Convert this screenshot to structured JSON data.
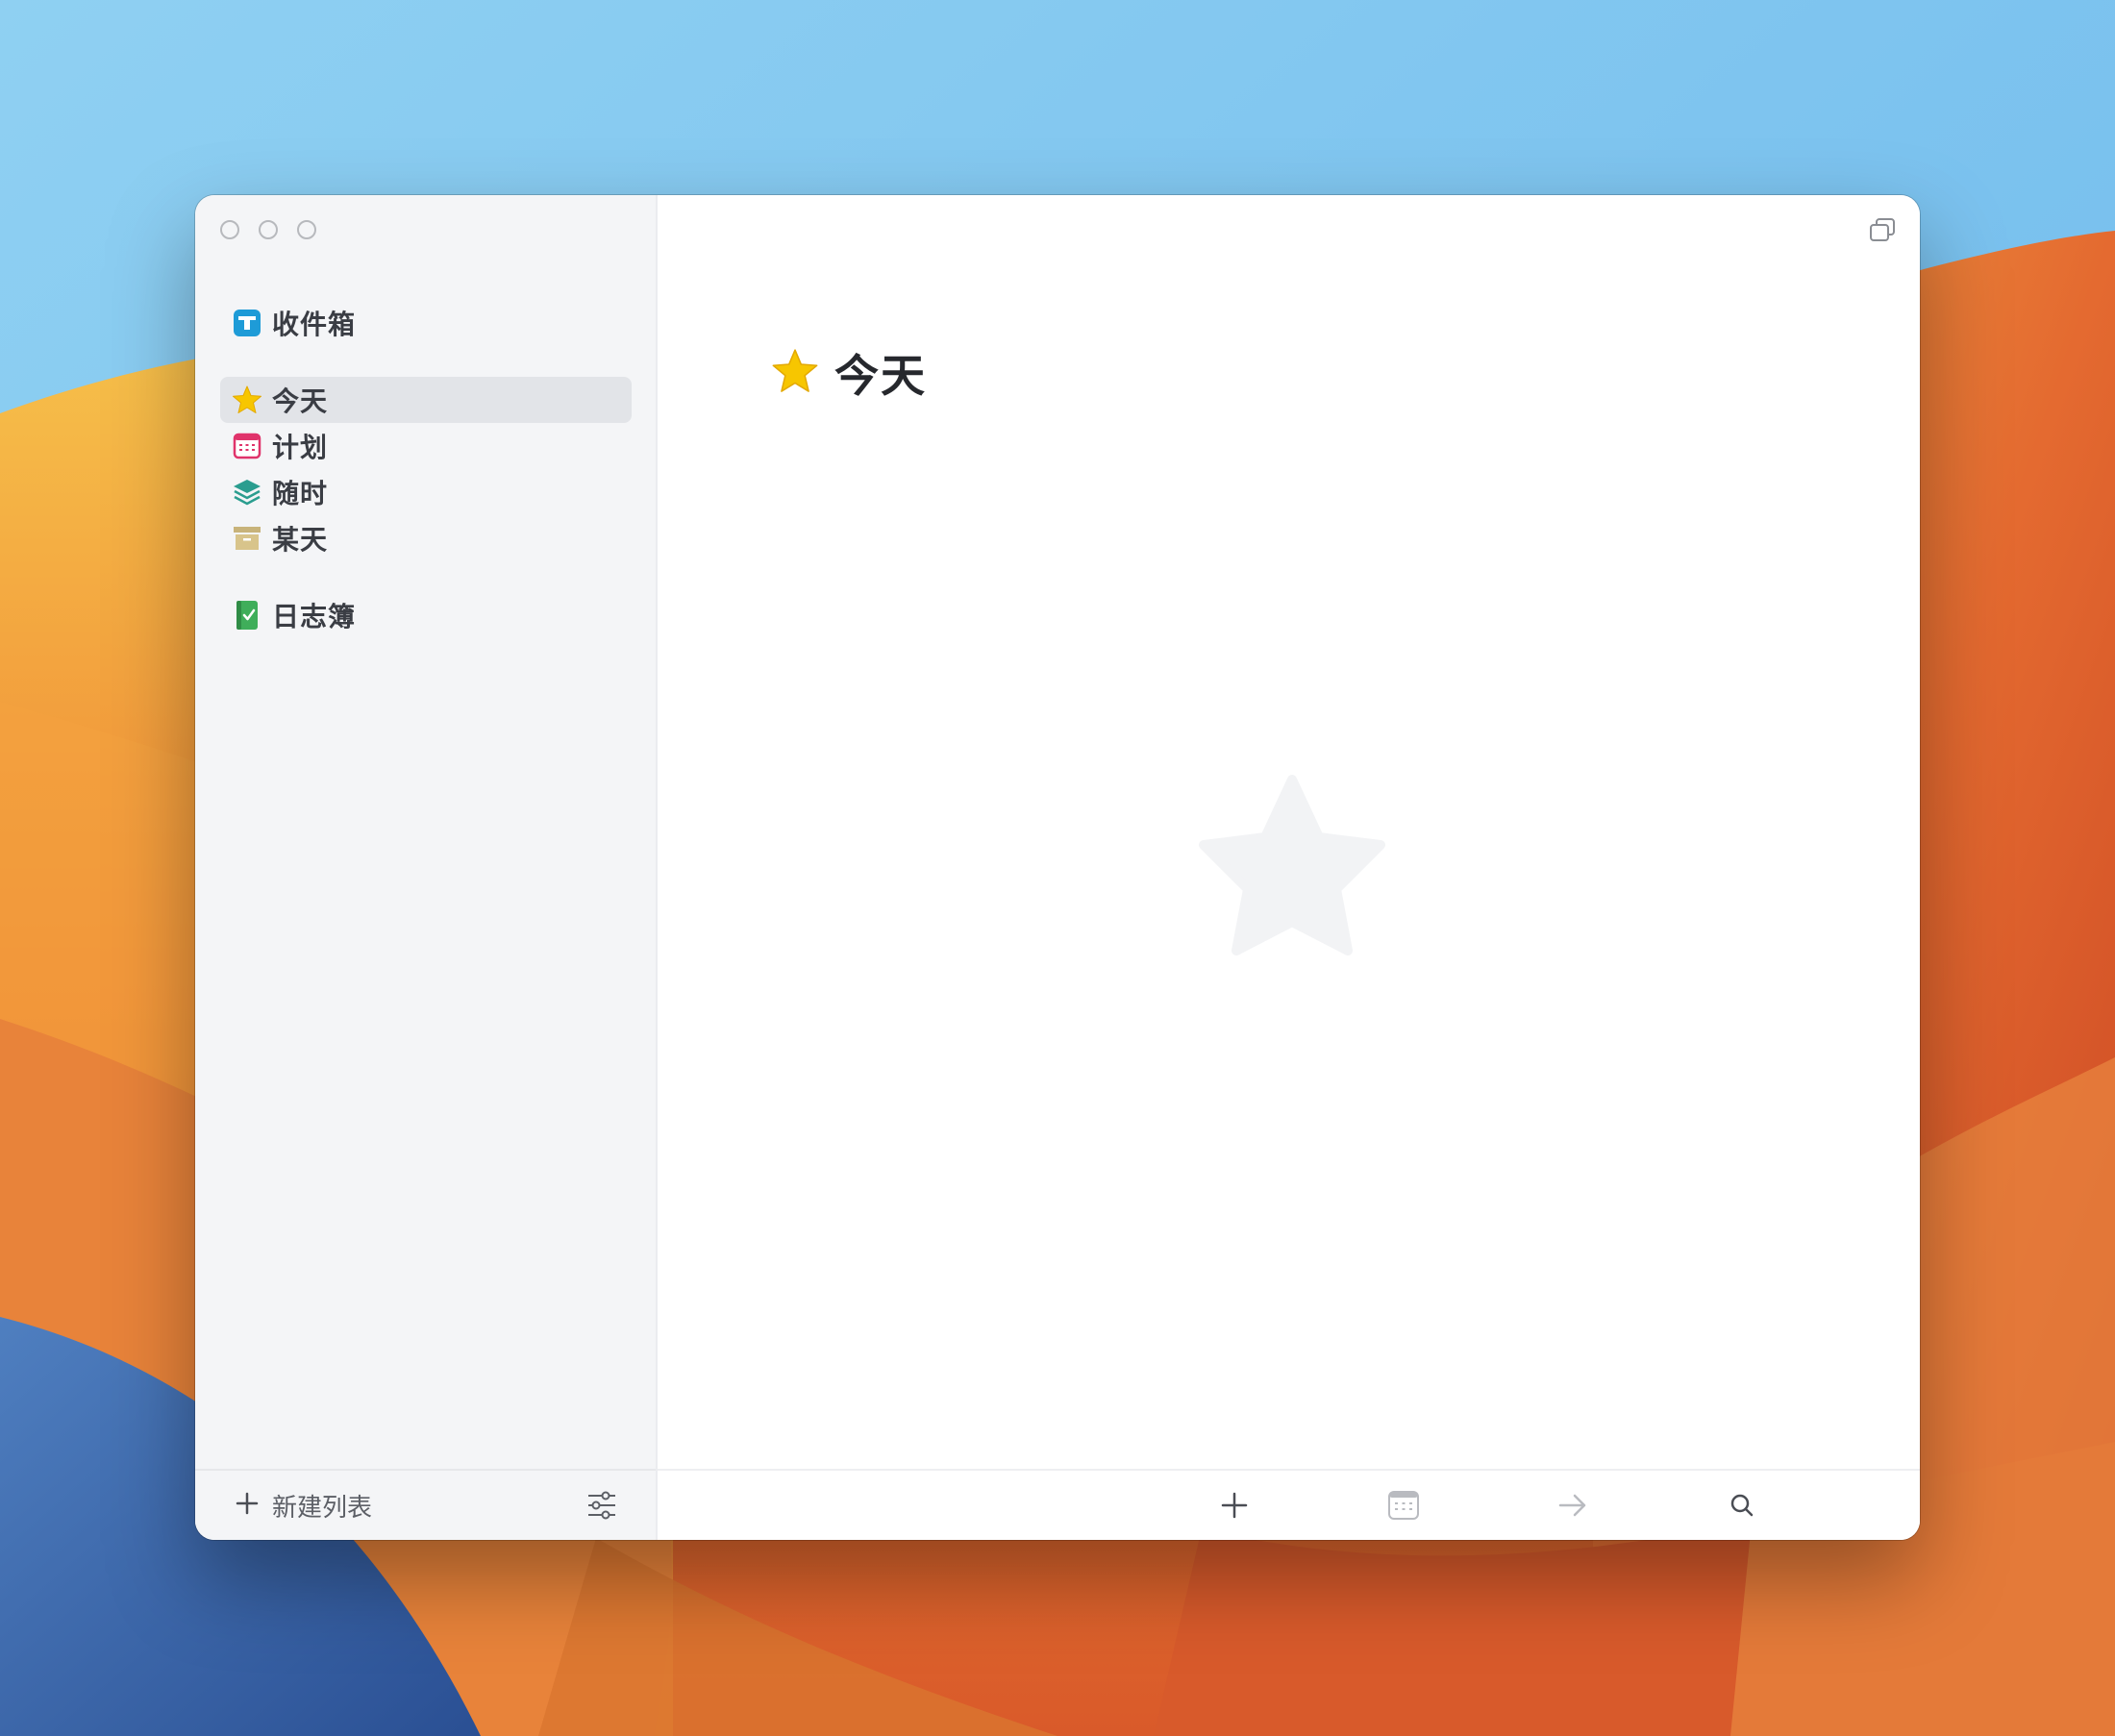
{
  "sidebar": {
    "inbox": {
      "label": "收件箱",
      "icon": "inbox-icon"
    },
    "items": [
      {
        "label": "今天",
        "icon": "star-icon",
        "selected": true
      },
      {
        "label": "计划",
        "icon": "calendar-icon",
        "selected": false
      },
      {
        "label": "随时",
        "icon": "layers-icon",
        "selected": false
      },
      {
        "label": "某天",
        "icon": "archive-box-icon",
        "selected": false
      }
    ],
    "logbook": {
      "label": "日志簿",
      "icon": "logbook-icon"
    },
    "footer": {
      "new_list_label": "新建列表",
      "new_list_icon": "plus-icon",
      "settings_icon": "sliders-icon"
    }
  },
  "main": {
    "title": "今天",
    "title_icon": "star-icon",
    "empty_state_icon": "star-icon",
    "toolbar": [
      {
        "icon": "plus-icon",
        "enabled": true
      },
      {
        "icon": "calendar-icon",
        "enabled": false
      },
      {
        "icon": "arrow-right-icon",
        "enabled": false
      },
      {
        "icon": "search-icon",
        "enabled": true
      }
    ],
    "window_icon": "duplicate-window-icon"
  },
  "colors": {
    "star": "#f7c600",
    "inbox": "#1e9bd7",
    "calendar": "#e0336b",
    "layers": "#2a9d8f",
    "archive": "#c8b37a",
    "logbook": "#3fae5a",
    "selection": "#e2e4e8",
    "sidebar_bg": "#f4f5f7"
  }
}
